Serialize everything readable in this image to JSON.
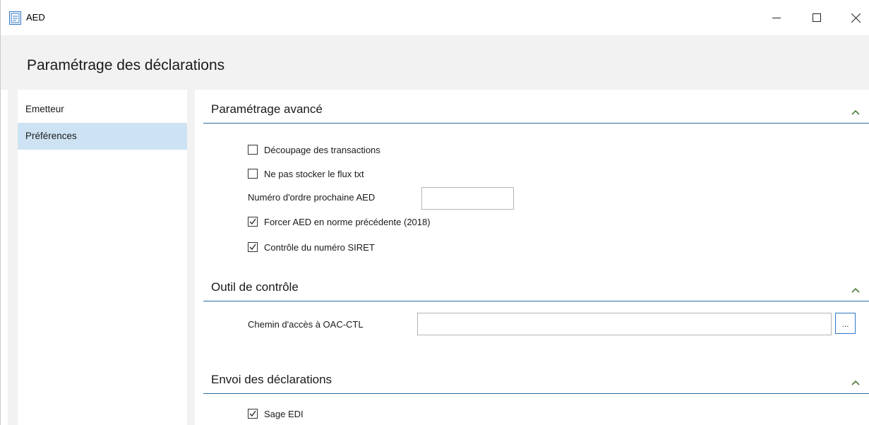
{
  "window": {
    "title": "AED",
    "icons": [
      "app-icon",
      "minimize-icon",
      "maximize-icon",
      "close-icon"
    ]
  },
  "header": {
    "title": "Paramétrage des déclarations"
  },
  "sidebar": {
    "items": [
      {
        "label": "Emetteur",
        "active": false
      },
      {
        "label": "Préférences",
        "active": true
      }
    ]
  },
  "sections": {
    "advanced": {
      "title": "Paramétrage avancé",
      "checkbox_split": {
        "label": "Découpage des transactions",
        "checked": false
      },
      "checkbox_nostore": {
        "label": "Ne pas stocker le flux txt",
        "checked": false
      },
      "order_number": {
        "label": "Numéro d'ordre prochaine AED",
        "value": ""
      },
      "checkbox_force": {
        "label": "Forcer AED en norme précédente (2018)",
        "checked": true
      },
      "checkbox_siret": {
        "label": "Contrôle du numéro SIRET",
        "checked": true
      }
    },
    "control_tool": {
      "title": "Outil de contrôle",
      "path": {
        "label": "Chemin d'accès à OAC-CTL",
        "value": ""
      },
      "browse_label": "..."
    },
    "sending": {
      "title": "Envoi des déclarations",
      "checkbox_edi": {
        "label": "Sage EDI",
        "checked": true
      }
    }
  },
  "colors": {
    "accent": "#2f6fa5",
    "chevron": "#4a7f3a",
    "selected": "#cde3f3",
    "panel_bg": "#f2f2f2"
  }
}
